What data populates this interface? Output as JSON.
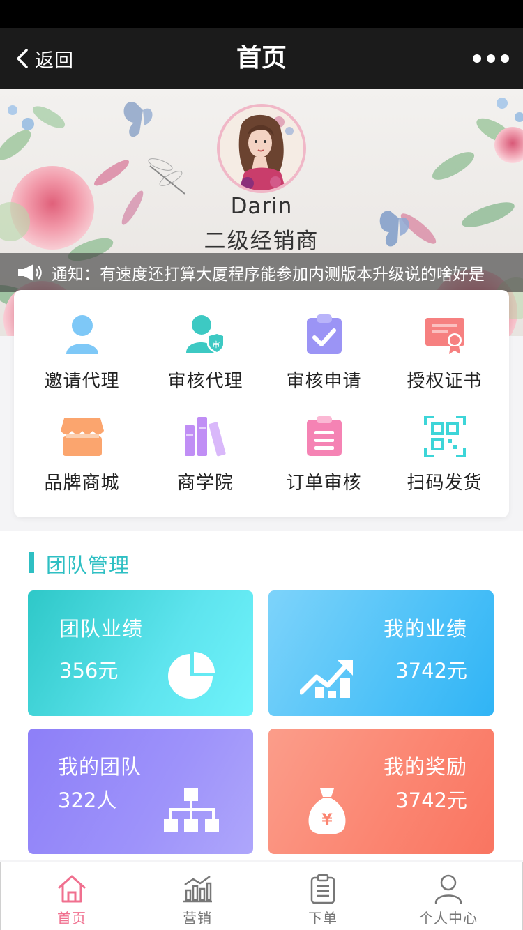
{
  "nav": {
    "back_label": "返回",
    "title": "首页"
  },
  "profile": {
    "name": "Darin",
    "level": "二级经销商"
  },
  "notice": {
    "text": "通知：有速度还打算大厦程序能参加内测版本升级说的啥好是"
  },
  "menu": {
    "items": [
      {
        "label": "邀请代理",
        "icon": "person-icon",
        "color": "#7ec8f7"
      },
      {
        "label": "审核代理",
        "icon": "person-shield-icon",
        "color": "#3dc9c3"
      },
      {
        "label": "审核申请",
        "icon": "clipboard-check-icon",
        "color": "#9b94f5"
      },
      {
        "label": "授权证书",
        "icon": "certificate-icon",
        "color": "#f68080"
      },
      {
        "label": "品牌商城",
        "icon": "shop-icon",
        "color": "#fba56e"
      },
      {
        "label": "商学院",
        "icon": "books-icon",
        "color": "#c08ef5"
      },
      {
        "label": "订单审核",
        "icon": "order-list-icon",
        "color": "#f583b4"
      },
      {
        "label": "扫码发货",
        "icon": "qr-scan-icon",
        "color": "#3dd5d8"
      }
    ]
  },
  "team": {
    "title": "团队管理",
    "accent_color": "#2ebfc3",
    "cards": [
      {
        "title": "团队业绩",
        "value": "356元",
        "icon": "pie-chart-icon"
      },
      {
        "title": "我的业绩",
        "value": "3742元",
        "icon": "trend-up-icon"
      },
      {
        "title": "我的团队",
        "value": "322人",
        "icon": "org-chart-icon"
      },
      {
        "title": "我的奖励",
        "value": "3742元",
        "icon": "money-bag-icon"
      }
    ]
  },
  "tabbar": {
    "active_color": "#f0708f",
    "tabs": [
      {
        "label": "首页",
        "icon": "home-icon"
      },
      {
        "label": "营销",
        "icon": "bar-chart-icon"
      },
      {
        "label": "下单",
        "icon": "order-icon"
      },
      {
        "label": "个人中心",
        "icon": "user-icon"
      }
    ]
  }
}
